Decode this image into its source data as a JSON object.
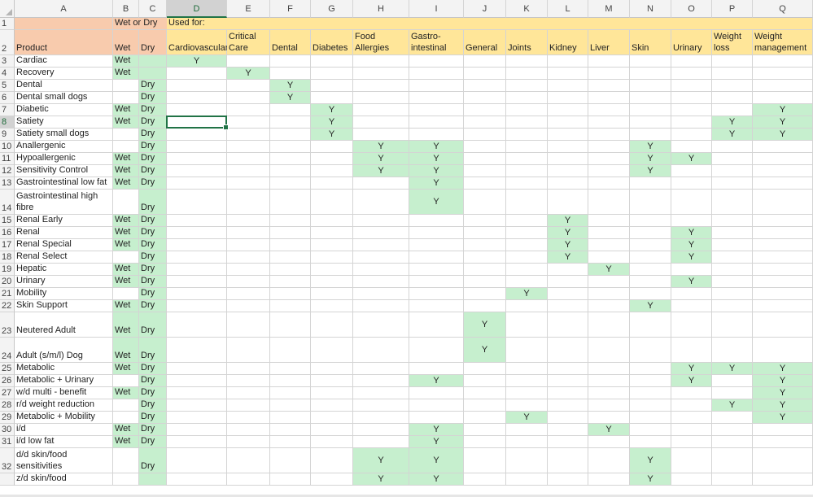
{
  "columns": [
    "A",
    "B",
    "C",
    "D",
    "E",
    "F",
    "G",
    "H",
    "I",
    "J",
    "K",
    "L",
    "M",
    "N",
    "O",
    "P",
    "Q"
  ],
  "selected_column": "D",
  "selected_row": "8",
  "header_row1": {
    "wet_or_dry": "Wet or Dry",
    "used_for": "Used for:"
  },
  "header_row2": {
    "product": "Product",
    "wet": "Wet",
    "dry": "Dry",
    "conditions": [
      "Cardiovascular",
      "Critical Care",
      "Dental",
      "Diabetes",
      "Food Allergies",
      "Gastro-intestinal",
      "General",
      "Joints",
      "Kidney",
      "Liver",
      "Skin",
      "Urinary",
      "Weight loss",
      "Weight management"
    ]
  },
  "mark": "Y",
  "rows": [
    {
      "n": "3",
      "product": "Cardiac",
      "wet": "Wet",
      "dry": "",
      "y": [
        "D"
      ]
    },
    {
      "n": "4",
      "product": "Recovery",
      "wet": "Wet",
      "dry": "",
      "y": [
        "E"
      ]
    },
    {
      "n": "5",
      "product": "Dental",
      "wet": "",
      "dry": "Dry",
      "y": [
        "F"
      ]
    },
    {
      "n": "6",
      "product": "Dental small dogs",
      "wet": "",
      "dry": "Dry",
      "y": [
        "F"
      ]
    },
    {
      "n": "7",
      "product": "Diabetic",
      "wet": "Wet",
      "dry": "Dry",
      "y": [
        "G",
        "Q"
      ]
    },
    {
      "n": "8",
      "product": "Satiety",
      "wet": "Wet",
      "dry": "Dry",
      "y": [
        "G",
        "P",
        "Q"
      ]
    },
    {
      "n": "9",
      "product": "Satiety small dogs",
      "wet": "",
      "dry": "Dry",
      "y": [
        "G",
        "P",
        "Q"
      ]
    },
    {
      "n": "10",
      "product": "Anallergenic",
      "wet": "",
      "dry": "Dry",
      "y": [
        "H",
        "I",
        "N"
      ]
    },
    {
      "n": "11",
      "product": "Hypoallergenic",
      "wet": "Wet",
      "dry": "Dry",
      "y": [
        "H",
        "I",
        "N",
        "O"
      ]
    },
    {
      "n": "12",
      "product": "Sensitivity Control",
      "wet": "Wet",
      "dry": "Dry",
      "y": [
        "H",
        "I",
        "N"
      ]
    },
    {
      "n": "13",
      "product": "Gastrointestinal low fat",
      "wet": "Wet",
      "dry": "Dry",
      "y": [
        "I"
      ]
    },
    {
      "n": "14",
      "product": "Gastrointestinal high fibre",
      "wet": "",
      "dry": "Dry",
      "y": [
        "I"
      ]
    },
    {
      "n": "15",
      "product": "Renal Early",
      "wet": "Wet",
      "dry": "Dry",
      "y": [
        "L"
      ]
    },
    {
      "n": "16",
      "product": "Renal",
      "wet": "Wet",
      "dry": "Dry",
      "y": [
        "L",
        "O"
      ]
    },
    {
      "n": "17",
      "product": "Renal Special",
      "wet": "Wet",
      "dry": "Dry",
      "y": [
        "L",
        "O"
      ]
    },
    {
      "n": "18",
      "product": "Renal Select",
      "wet": "",
      "dry": "Dry",
      "y": [
        "L",
        "O"
      ]
    },
    {
      "n": "19",
      "product": "Hepatic",
      "wet": "Wet",
      "dry": "Dry",
      "y": [
        "M"
      ]
    },
    {
      "n": "20",
      "product": "Urinary",
      "wet": "Wet",
      "dry": "Dry",
      "y": [
        "O"
      ]
    },
    {
      "n": "21",
      "product": "Mobility",
      "wet": "",
      "dry": "Dry",
      "y": [
        "K"
      ]
    },
    {
      "n": "22",
      "product": "Skin Support",
      "wet": "Wet",
      "dry": "Dry",
      "y": [
        "N"
      ]
    },
    {
      "n": "23",
      "product": "Neutered Adult",
      "wet": "Wet",
      "dry": "Dry",
      "y": [
        "J"
      ]
    },
    {
      "n": "24",
      "product": "Adult (s/m/l) Dog",
      "wet": "Wet",
      "dry": "Dry",
      "y": [
        "J"
      ]
    },
    {
      "n": "25",
      "product": "Metabolic",
      "wet": "Wet",
      "dry": "Dry",
      "y": [
        "O",
        "P",
        "Q"
      ]
    },
    {
      "n": "26",
      "product": "Metabolic + Urinary",
      "wet": "",
      "dry": "Dry",
      "y": [
        "I",
        "O",
        "Q"
      ]
    },
    {
      "n": "27",
      "product": "w/d multi - benefit",
      "wet": "Wet",
      "dry": "Dry",
      "y": [
        "Q"
      ]
    },
    {
      "n": "28",
      "product": "r/d weight reduction",
      "wet": "",
      "dry": "Dry",
      "y": [
        "P",
        "Q"
      ]
    },
    {
      "n": "29",
      "product": "Metabolic + Mobility",
      "wet": "",
      "dry": "Dry",
      "y": [
        "K",
        "Q"
      ]
    },
    {
      "n": "30",
      "product": "i/d",
      "wet": "Wet",
      "dry": "Dry",
      "y": [
        "I",
        "M"
      ]
    },
    {
      "n": "31",
      "product": "i/d low fat",
      "wet": "Wet",
      "dry": "Dry",
      "y": [
        "I"
      ]
    },
    {
      "n": "32",
      "product": "d/d skin/food sensitivities",
      "wet": "",
      "dry": "Dry",
      "y": [
        "H",
        "I",
        "N"
      ]
    },
    {
      "n": "",
      "product": "z/d skin/food",
      "wet": "",
      "dry": "",
      "y": [
        "H",
        "I",
        "N"
      ]
    }
  ],
  "colors": {
    "header_peach": "#f8cbad",
    "header_yellow": "#ffe699",
    "green": "#c6efce",
    "selection": "#217346"
  }
}
